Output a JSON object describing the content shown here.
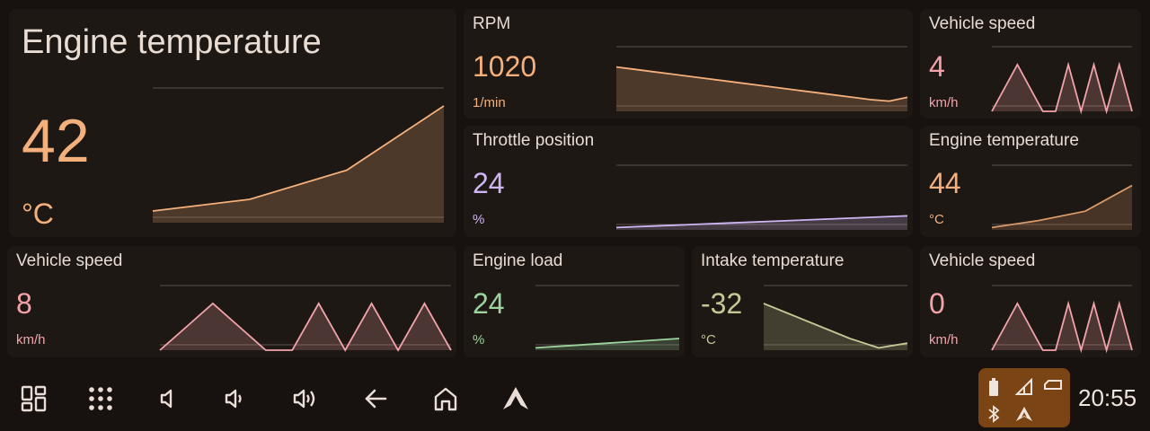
{
  "colors": {
    "orange": "#f4b07c",
    "purple": "#cdb6f3",
    "pink": "#f2a3aa",
    "green": "#9bd49f",
    "olive": "#c6c795",
    "orange_dim": "#d99a6a",
    "status_bg": "#7a4414"
  },
  "widgets": [
    {
      "id": "engine_temp_big",
      "title": "Engine temperature",
      "value": "42",
      "unit": "°C",
      "color": "orange",
      "points": [
        0.1,
        0.2,
        0.45,
        1.0
      ]
    },
    {
      "id": "rpm",
      "title": "RPM",
      "value": "1020",
      "unit": "1/min",
      "color": "orange",
      "points": [
        0.95,
        0.9,
        0.85,
        0.8,
        0.75,
        0.7,
        0.65,
        0.6,
        0.55,
        0.5,
        0.45,
        0.4,
        0.35,
        0.3,
        0.25,
        0.22,
        0.3
      ]
    },
    {
      "id": "vehicle_speed_1",
      "title": "Vehicle speed",
      "value": "4",
      "unit": "km/h",
      "color": "pink",
      "points": [
        0,
        0.5,
        1,
        0.5,
        0,
        0,
        1,
        0,
        1,
        0,
        1,
        0
      ]
    },
    {
      "id": "throttle",
      "title": "Throttle position",
      "value": "24",
      "unit": "%",
      "color": "purple",
      "points": [
        0.05,
        0.1,
        0.15,
        0.2,
        0.25,
        0.3
      ]
    },
    {
      "id": "engine_temp_small",
      "title": "Engine temperature",
      "value": "44",
      "unit": "°C",
      "color": "orange_dim",
      "points": [
        0.05,
        0.2,
        0.4,
        0.95
      ]
    },
    {
      "id": "vehicle_speed_2",
      "title": "Vehicle speed",
      "value": "8",
      "unit": "km/h",
      "color": "pink",
      "points": [
        0,
        0.5,
        1,
        0.5,
        0,
        0,
        1,
        0,
        1,
        0,
        1,
        0
      ]
    },
    {
      "id": "engine_load",
      "title": "Engine load",
      "value": "24",
      "unit": "%",
      "color": "green",
      "points": [
        0.05,
        0.1,
        0.15,
        0.2,
        0.25
      ]
    },
    {
      "id": "intake_temp",
      "title": "Intake temperature",
      "value": "-32",
      "unit": "°C",
      "color": "olive",
      "points": [
        1,
        0.75,
        0.5,
        0.25,
        0.05,
        0.15
      ]
    },
    {
      "id": "vehicle_speed_3",
      "title": "Vehicle speed",
      "value": "0",
      "unit": "km/h",
      "color": "pink",
      "points": [
        0,
        0.5,
        1,
        0.5,
        0,
        0,
        1,
        0,
        1,
        0,
        1,
        0
      ]
    }
  ],
  "nav": [
    {
      "name": "dashboard-icon"
    },
    {
      "name": "apps-grid-icon"
    },
    {
      "name": "volume-mute-icon"
    },
    {
      "name": "volume-low-icon"
    },
    {
      "name": "volume-high-icon"
    },
    {
      "name": "back-arrow-icon"
    },
    {
      "name": "home-icon"
    },
    {
      "name": "android-auto-icon"
    }
  ],
  "status": {
    "icons": [
      "battery-icon",
      "cell-signal-icon",
      "car-icon",
      "bluetooth-icon",
      "android-auto-small-icon"
    ],
    "time": "20:55"
  }
}
